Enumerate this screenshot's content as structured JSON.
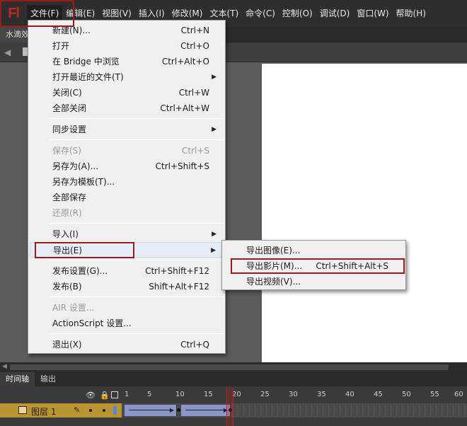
{
  "app": {
    "logo": "Fl"
  },
  "menubar": {
    "items": [
      "文件(F)",
      "编辑(E)",
      "视图(V)",
      "插入(I)",
      "修改(M)",
      "文本(T)",
      "命令(C)",
      "控制(O)",
      "调试(D)",
      "窗口(W)",
      "帮助(H)"
    ]
  },
  "document": {
    "tab_label": "水滴效"
  },
  "file_menu": {
    "items": [
      {
        "label": "新建(N)...",
        "shortcut": "Ctrl+N"
      },
      {
        "label": "打开",
        "shortcut": "Ctrl+O"
      },
      {
        "label": "在 Bridge 中浏览",
        "shortcut": "Ctrl+Alt+O"
      },
      {
        "label": "打开最近的文件(T)",
        "shortcut": ""
      },
      {
        "label": "关闭(C)",
        "shortcut": "Ctrl+W"
      },
      {
        "label": "全部关闭",
        "shortcut": "Ctrl+Alt+W"
      },
      {
        "label": "同步设置",
        "shortcut": ""
      },
      {
        "label": "保存(S)",
        "shortcut": "Ctrl+S"
      },
      {
        "label": "另存为(A)...",
        "shortcut": "Ctrl+Shift+S"
      },
      {
        "label": "另存为模板(T)...",
        "shortcut": ""
      },
      {
        "label": "全部保存",
        "shortcut": ""
      },
      {
        "label": "还原(R)",
        "shortcut": ""
      },
      {
        "label": "导入(I)",
        "shortcut": ""
      },
      {
        "label": "导出(E)",
        "shortcut": ""
      },
      {
        "label": "发布设置(G)...",
        "shortcut": "Ctrl+Shift+F12"
      },
      {
        "label": "发布(B)",
        "shortcut": "Shift+Alt+F12"
      },
      {
        "label": "AIR 设置...",
        "shortcut": ""
      },
      {
        "label": "ActionScript 设置...",
        "shortcut": ""
      },
      {
        "label": "退出(X)",
        "shortcut": "Ctrl+Q"
      }
    ]
  },
  "export_submenu": {
    "items": [
      {
        "label": "导出图像(E)...",
        "shortcut": ""
      },
      {
        "label": "导出影片(M)...",
        "shortcut": "Ctrl+Shift+Alt+S"
      },
      {
        "label": "导出视频(V)...",
        "shortcut": ""
      }
    ]
  },
  "panels": {
    "tabs": [
      "时间轴",
      "输出"
    ]
  },
  "timeline": {
    "frame_numbers": [
      "1",
      "5",
      "10",
      "15",
      "20",
      "25",
      "30",
      "35",
      "40",
      "45",
      "50",
      "55",
      "60"
    ],
    "current_frame": 20,
    "layer_name": "图层 1"
  },
  "colors": {
    "accent_red": "#9b1a1a",
    "layer_bar": "#b99432",
    "tween": "#8a95c8",
    "stage": "#ffffff"
  }
}
